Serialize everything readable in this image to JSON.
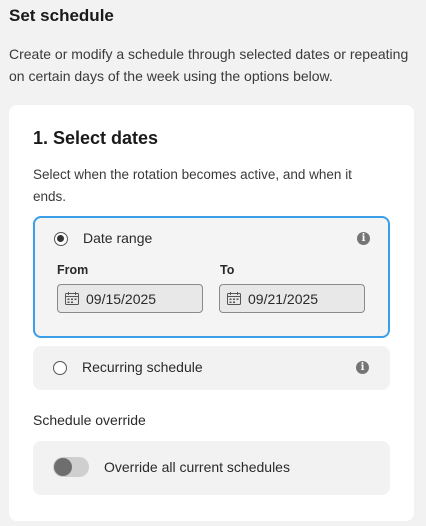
{
  "header": {
    "title": "Set schedule",
    "description": "Create or modify a schedule through selected dates or repeating on certain days of the week using the options below."
  },
  "select_dates": {
    "title": "1. Select dates",
    "description": "Select when the rotation becomes active, and when it ends."
  },
  "date_range": {
    "label": "Date range",
    "selected": true,
    "from_label": "From",
    "from_value": "09/15/2025",
    "to_label": "To",
    "to_value": "09/21/2025",
    "info_icon": "info-icon"
  },
  "recurring": {
    "label": "Recurring schedule",
    "selected": false,
    "info_icon": "info-icon"
  },
  "override": {
    "section_label": "Schedule override",
    "toggle_label": "Override all current schedules",
    "enabled": false
  },
  "colors": {
    "accent_border": "#3b9ee8",
    "background": "#f2f2f2",
    "card": "#ffffff"
  }
}
